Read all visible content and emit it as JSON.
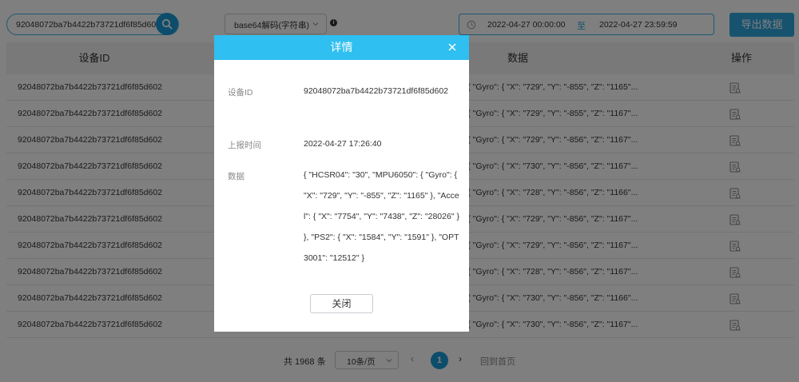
{
  "toolbar": {
    "search_value": "92048072ba7b4422b73721df6f85d602",
    "decode_select": "base64解码(字符串)",
    "date_start": "2022-04-27 00:00:00",
    "date_separator": "至",
    "date_end": "2022-04-27 23:59:59",
    "export_label": "导出数据"
  },
  "table": {
    "headers": {
      "device_id": "设备ID",
      "data": "数据",
      "action": "操作"
    },
    "rows": [
      {
        "device_id": "92048072ba7b4422b73721df6f85d602",
        "data": "50\": { \"Gyro\": { \"X\": \"729\", \"Y\": \"-855\", \"Z\": \"1165\"..."
      },
      {
        "device_id": "92048072ba7b4422b73721df6f85d602",
        "data": "50\": { \"Gyro\": { \"X\": \"729\", \"Y\": \"-855\", \"Z\": \"1167\"..."
      },
      {
        "device_id": "92048072ba7b4422b73721df6f85d602",
        "data": "50\": { \"Gyro\": { \"X\": \"729\", \"Y\": \"-856\", \"Z\": \"1167\"..."
      },
      {
        "device_id": "92048072ba7b4422b73721df6f85d602",
        "data": "50\": { \"Gyro\": { \"X\": \"730\", \"Y\": \"-856\", \"Z\": \"1167\"..."
      },
      {
        "device_id": "92048072ba7b4422b73721df6f85d602",
        "data": "50\": { \"Gyro\": { \"X\": \"728\", \"Y\": \"-856\", \"Z\": \"1166\"..."
      },
      {
        "device_id": "92048072ba7b4422b73721df6f85d602",
        "data": "50\": { \"Gyro\": { \"X\": \"729\", \"Y\": \"-856\", \"Z\": \"1167\"..."
      },
      {
        "device_id": "92048072ba7b4422b73721df6f85d602",
        "data": "50\": { \"Gyro\": { \"X\": \"729\", \"Y\": \"-856\", \"Z\": \"1167\"..."
      },
      {
        "device_id": "92048072ba7b4422b73721df6f85d602",
        "data": "50\": { \"Gyro\": { \"X\": \"728\", \"Y\": \"-856\", \"Z\": \"1167\"..."
      },
      {
        "device_id": "92048072ba7b4422b73721df6f85d602",
        "data": "50\": { \"Gyro\": { \"X\": \"730\", \"Y\": \"-856\", \"Z\": \"1166\"..."
      },
      {
        "device_id": "92048072ba7b4422b73721df6f85d602",
        "data": "50\": { \"Gyro\": { \"X\": \"730\", \"Y\": \"-856\", \"Z\": \"1167\"..."
      }
    ]
  },
  "pagination": {
    "total": "共 1968 条",
    "page_size": "10条/页",
    "current_page": "1",
    "first_page": "回到首页"
  },
  "dialog": {
    "title": "详情",
    "device_id_label": "设备ID",
    "device_id_value": "92048072ba7b4422b73721df6f85d602",
    "report_time_label": "上报时间",
    "report_time_value": "2022-04-27 17:26:40",
    "data_label": "数据",
    "data_value": "{ \"HCSR04\": \"30\", \"MPU6050\": { \"Gyro\": { \"X\": \"729\", \"Y\": \"-855\", \"Z\": \"1165\" }, \"Accel\": { \"X\": \"7754\", \"Y\": \"7438\", \"Z\": \"28026\" } }, \"PS2\": { \"X\": \"1584\", \"Y\": \"1591\" }, \"OPT3001\": \"12512\" }",
    "close_label": "关闭"
  },
  "colors": {
    "accent": "#1a9bd6",
    "dialog_header": "#2fbff0",
    "export_button": "#2ea6df"
  },
  "icons": [
    "search-icon",
    "chevron-down-icon",
    "info-icon",
    "clock-icon",
    "detail-icon",
    "close-icon",
    "chevron-left-icon",
    "chevron-right-icon"
  ]
}
